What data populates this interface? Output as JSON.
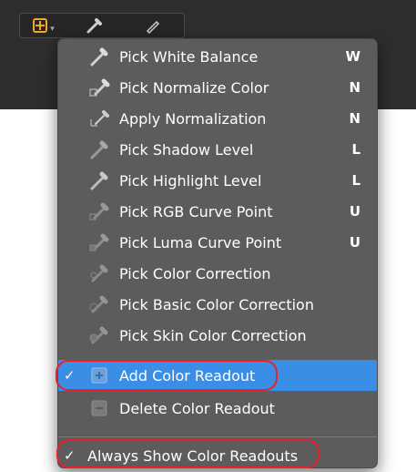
{
  "menu": {
    "items": [
      {
        "label": "Pick White Balance",
        "shortcut": "W"
      },
      {
        "label": "Pick Normalize Color",
        "shortcut": "N"
      },
      {
        "label": "Apply Normalization",
        "shortcut": "N"
      },
      {
        "label": "Pick Shadow Level",
        "shortcut": "L"
      },
      {
        "label": "Pick Highlight Level",
        "shortcut": "L"
      },
      {
        "label": "Pick RGB Curve Point",
        "shortcut": "U"
      },
      {
        "label": "Pick Luma Curve Point",
        "shortcut": "U"
      },
      {
        "label": "Pick Color Correction",
        "shortcut": ""
      },
      {
        "label": "Pick Basic Color Correction",
        "shortcut": ""
      },
      {
        "label": "Pick Skin Color Correction",
        "shortcut": ""
      },
      {
        "label": "Add Color Readout",
        "shortcut": "",
        "check": "✓"
      },
      {
        "label": "Delete Color Readout",
        "shortcut": ""
      }
    ],
    "always_show": {
      "label": "Always Show Color Readouts",
      "check": "✓"
    }
  },
  "colors": {
    "accent": "#3a8ee6",
    "menu_bg": "#5c5c5c",
    "highlight_ring": "#e8212a",
    "tool_orange": "#f5a623"
  }
}
